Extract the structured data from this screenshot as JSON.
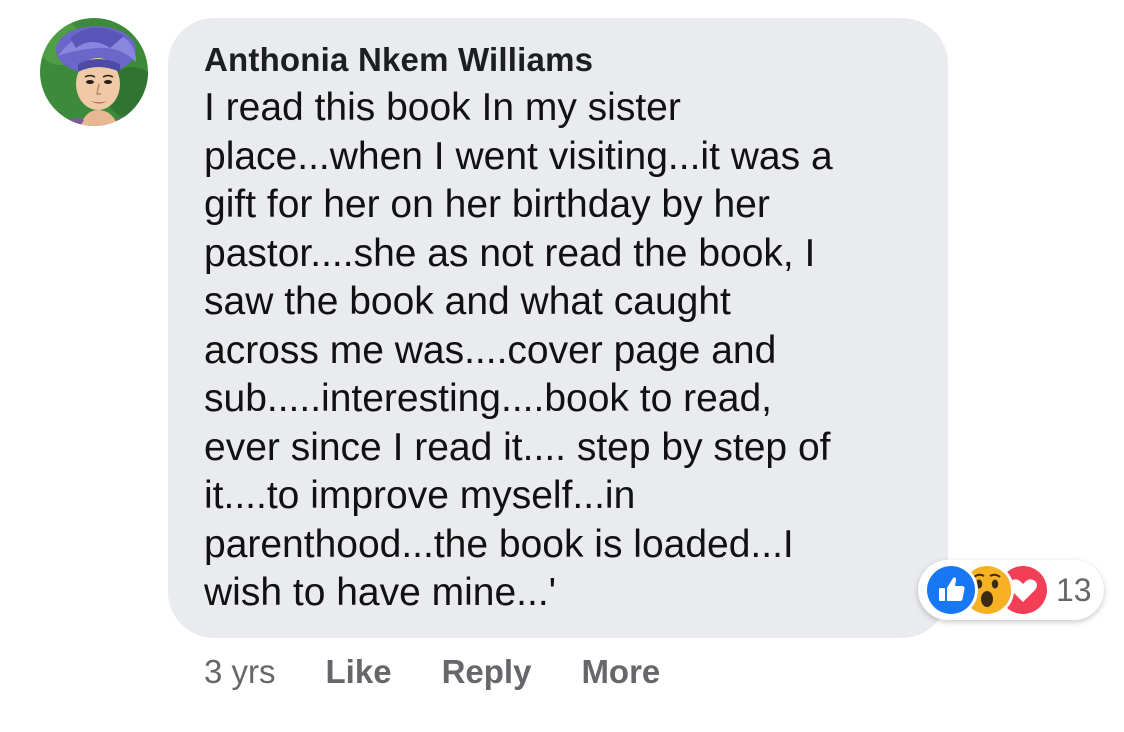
{
  "comment": {
    "author": "Anthonia Nkem Williams",
    "text": "I read this book In my sister\nplace...when I went visiting...it was a\ngift for her on her birthday by her\npastor....she as not read the book, I\nsaw the book and what caught\nacross me was....cover page and\nsub.....interesting....book to read,\never since I read it.... step by step of\nit....to improve myself...in\nparenthood...the book is loaded...I\nwish to have mine...'",
    "avatar_icon": "profile-avatar"
  },
  "reactions": {
    "icons": [
      "like-icon",
      "wow-icon",
      "love-icon"
    ],
    "count": "13",
    "colors": {
      "like": "#1877f2",
      "wow": "#f7b125",
      "love": "#f33e58"
    }
  },
  "actions": {
    "time": "3 yrs",
    "like_label": "Like",
    "reply_label": "Reply",
    "more_label": "More"
  },
  "colors": {
    "bubble": "#eaebef",
    "author": "#1c1e21",
    "text": "#111111",
    "muted": "#65676b"
  }
}
